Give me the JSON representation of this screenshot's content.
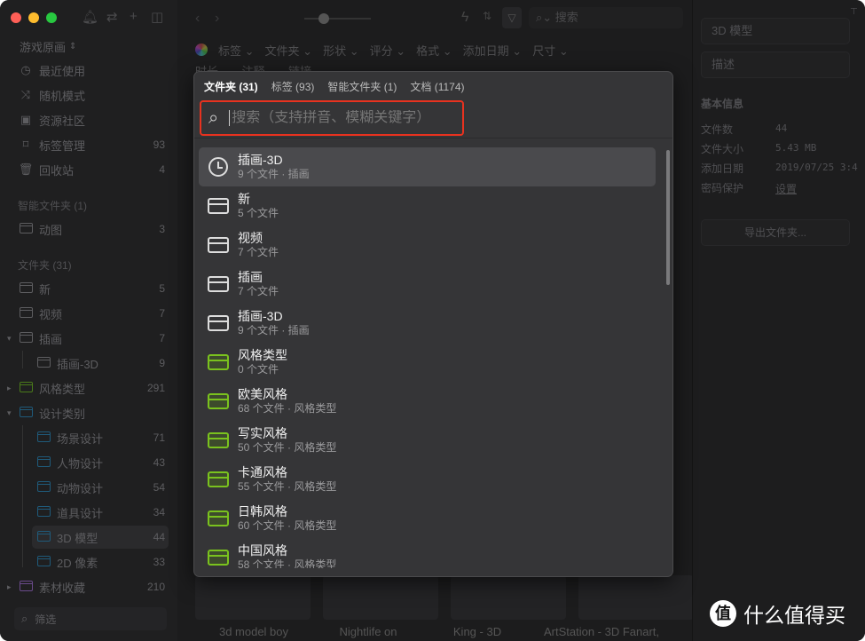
{
  "sidebar": {
    "library": "游戏原画",
    "nav": [
      {
        "label": "最近使用",
        "icon": "clock-icon",
        "count": ""
      },
      {
        "label": "随机模式",
        "icon": "shuffle-icon",
        "count": ""
      },
      {
        "label": "资源社区",
        "icon": "download-box-icon",
        "count": ""
      },
      {
        "label": "标签管理",
        "icon": "bookmark-icon",
        "count": "93"
      },
      {
        "label": "回收站",
        "icon": "trash-icon",
        "count": "4"
      }
    ],
    "smart_header": "智能文件夹 (1)",
    "smart": [
      {
        "label": "动图",
        "count": "3"
      }
    ],
    "folders_header": "文件夹 (31)",
    "folders": [
      {
        "label": "新",
        "count": "5",
        "color": "#5d5d60"
      },
      {
        "label": "视频",
        "count": "7",
        "color": "#5d5d60"
      },
      {
        "label": "插画",
        "count": "7",
        "color": "#5d5d60"
      },
      {
        "label": "插画-3D",
        "count": "9",
        "color": "#5d5d60"
      },
      {
        "label": "风格类型",
        "count": "291",
        "color": "#4a7a1a"
      },
      {
        "label": "设计类别",
        "count": "",
        "color": "#1f5a7a"
      },
      {
        "label": "场景设计",
        "count": "71",
        "color": "#1f5a7a"
      },
      {
        "label": "人物设计",
        "count": "43",
        "color": "#1f5a7a"
      },
      {
        "label": "动物设计",
        "count": "54",
        "color": "#1f5a7a"
      },
      {
        "label": "道具设计",
        "count": "34",
        "color": "#1f5a7a"
      },
      {
        "label": "3D 模型",
        "count": "44",
        "color": "#1f5a7a"
      },
      {
        "label": "2D 像素",
        "count": "33",
        "color": "#1f5a7a"
      },
      {
        "label": "素材收藏",
        "count": "210",
        "color": "#6a4a8a"
      }
    ],
    "filter_placeholder": "筛选"
  },
  "toolbar": {
    "search_placeholder": "搜索"
  },
  "filters": [
    "标签",
    "文件夹",
    "形状",
    "评分",
    "格式",
    "添加日期",
    "尺寸"
  ],
  "filters_row2": [
    "时长",
    "注释",
    "链接"
  ],
  "thumb_captions": [
    "3d model boy",
    "Nightlife on",
    "King - 3D",
    "ArtStation - 3D Fanart,"
  ],
  "right": {
    "name": "3D 模型",
    "desc_placeholder": "描述",
    "section": "基本信息",
    "rows": [
      {
        "label": "文件数",
        "value": "44"
      },
      {
        "label": "文件大小",
        "value": "5.43 MB"
      },
      {
        "label": "添加日期",
        "value": "2019/07/25 3:4"
      },
      {
        "label": "密码保护",
        "value": "设置"
      }
    ],
    "export": "导出文件夹..."
  },
  "popup": {
    "tabs": [
      "文件夹 (31)",
      "标签 (93)",
      "智能文件夹 (1)",
      "文档 (1174)"
    ],
    "search_placeholder": "搜索（支持拼音、模糊关键字）",
    "items": [
      {
        "name": "插画-3D",
        "sub": "9 个文件 · 插画",
        "icon": "clock-icon"
      },
      {
        "name": "新",
        "sub": "5 个文件",
        "icon": "folder-icon"
      },
      {
        "name": "视频",
        "sub": "7 个文件",
        "icon": "folder-icon"
      },
      {
        "name": "插画",
        "sub": "7 个文件",
        "icon": "folder-icon"
      },
      {
        "name": "插画-3D",
        "sub": "9 个文件 · 插画",
        "icon": "folder-icon"
      },
      {
        "name": "风格类型",
        "sub": "0 个文件",
        "icon": "green-folder-icon"
      },
      {
        "name": "欧美风格",
        "sub": "68 个文件 · 风格类型",
        "icon": "green-folder-icon"
      },
      {
        "name": "写实风格",
        "sub": "50 个文件 · 风格类型",
        "icon": "green-folder-icon"
      },
      {
        "name": "卡通风格",
        "sub": "55 个文件 · 风格类型",
        "icon": "green-folder-icon"
      },
      {
        "name": "日韩风格",
        "sub": "60 个文件 · 风格类型",
        "icon": "green-folder-icon"
      },
      {
        "name": "中国风格",
        "sub": "58 个文件 · 风格类型",
        "icon": "green-folder-icon"
      }
    ]
  },
  "watermark": {
    "mark": "值",
    "text": "什么值得买"
  }
}
